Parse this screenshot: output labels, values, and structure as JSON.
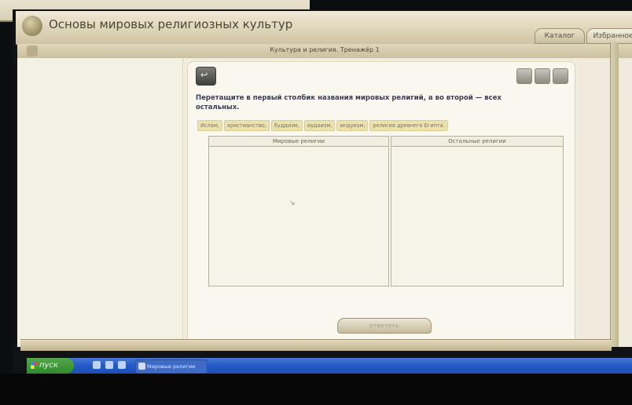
{
  "window": {
    "app_title": "Основы мировых религиозных культур",
    "catalog_label": "Каталог",
    "favorites_label": "Избранное",
    "page_subtitle": "Культура и религия. Тренажёр 1"
  },
  "exercise": {
    "instruction": "Перетащите в первый столбик названия мировых религий, а во второй — всех остальных.",
    "chips": [
      "Ислам,",
      "христианство,",
      "буддизм,",
      "иудаизм,",
      "индуизм,",
      "религия древнего Египта."
    ],
    "columns": [
      {
        "header": "Мировые религии"
      },
      {
        "header": "Остальные религии"
      }
    ],
    "answer_button": "ответить"
  },
  "taskbar": {
    "start_label": "пуск",
    "active_window": "Мировые религии"
  },
  "icons": {
    "back": "back-arrow-icon",
    "tools": [
      "print-icon",
      "note-icon",
      "help-icon"
    ],
    "app": "app-logo-icon"
  },
  "colors": {
    "taskbar": "#245bc8",
    "start_button": "#2f8a2b",
    "chip_bg": "#ece2b0",
    "instruction_text": "#3b3f55"
  }
}
